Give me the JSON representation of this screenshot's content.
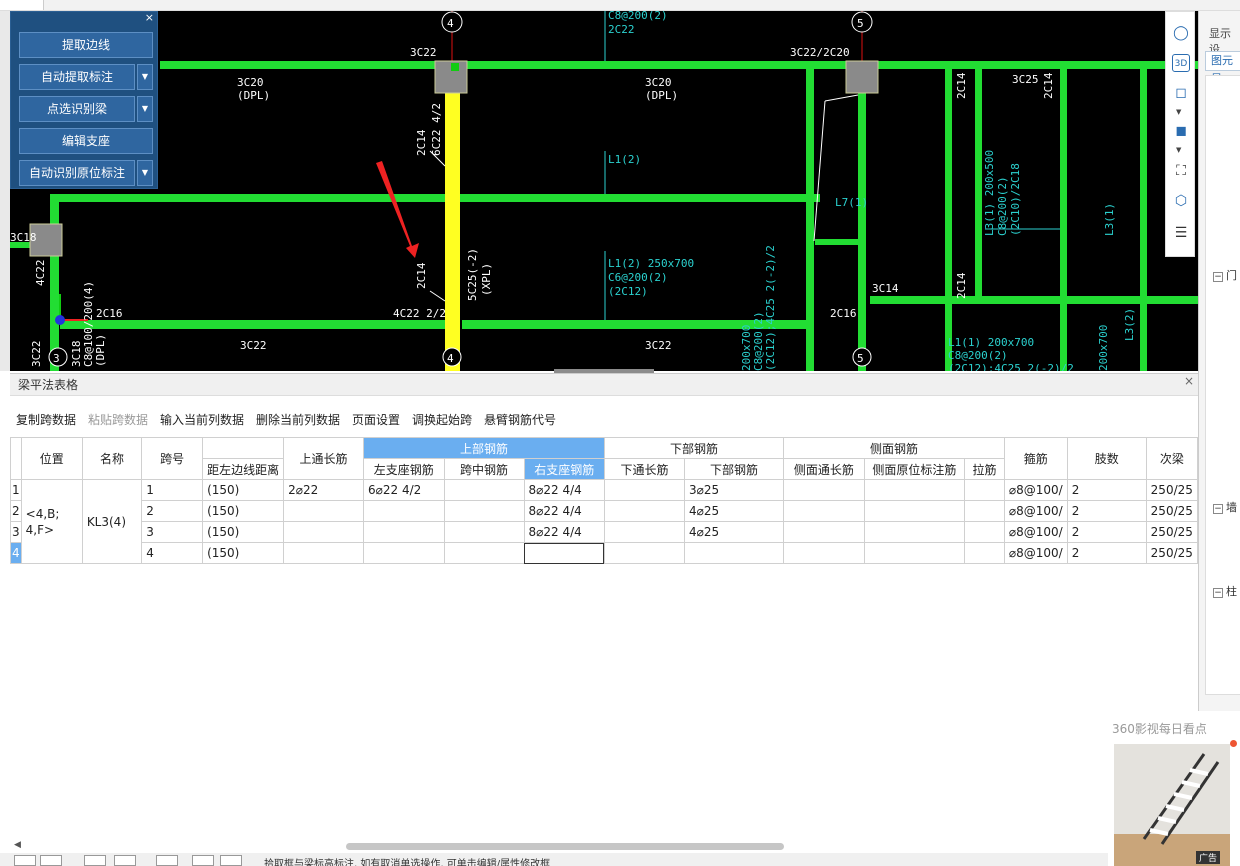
{
  "toolpanel": {
    "buttons": [
      "提取边线",
      "自动提取标注",
      "点选识别梁",
      "编辑支座",
      "自动识别原位标注"
    ],
    "close": "×"
  },
  "canvas": {
    "axis_labels": {
      "top_4": "4",
      "top_5": "5",
      "bottom_3": "3",
      "bottom_4": "4",
      "bottom_5": "5"
    },
    "texts": [
      "3C22",
      "3C22/2C20",
      "3C20",
      "(DPL)",
      "3C20",
      "(DPL)",
      "2C14",
      "6C22 4/2",
      "C8@200(2)",
      "2C22",
      "L1(2)",
      "2C14",
      "3C25",
      "2C14",
      "L7(1)",
      "L3(1) 200x500",
      "C8@200(2)",
      "(2C10)/2C18",
      "L3(1)",
      "2C14",
      "5C25(-2)",
      "(XPL)",
      "L1(2) 250x700",
      "C6@200(2)",
      "(2C12)",
      "3C18",
      "4C22",
      "2C16",
      "4C22 2/2",
      "2C16",
      "3C14",
      "2C14",
      "3C22",
      "3C22",
      "3C22",
      "3C18",
      "C8@100/200(4)",
      "(DPL)",
      "L1(1) 200x700",
      "C8@200(2)",
      "(2C12);4C25 2(-2)/2",
      "200x700",
      "C8@200(2)",
      "(2C12);4C25 2(-2)/2",
      "200x700",
      "L3(2)"
    ]
  },
  "vtool": {
    "icons": [
      "3d-orbit-icon",
      "3d-view-icon",
      "cube-outline-icon",
      "cube-solid-icon",
      "fit-window-icon",
      "select-box-icon",
      "layer-settings-icon"
    ],
    "label_3d": "3D"
  },
  "rightpanel": {
    "title": "显示设",
    "tab": "图元显",
    "sections": [
      "门",
      "墙",
      "柱"
    ],
    "collapse": "−"
  },
  "bottompanel": {
    "title": "梁平法表格",
    "close": "×",
    "toolbar": [
      "复制跨数据",
      "粘贴跨数据",
      "输入当前列数据",
      "删除当前列数据",
      "页面设置",
      "调换起始跨",
      "悬臂钢筋代号"
    ],
    "columns": {
      "position": "位置",
      "name": "名称",
      "span": "跨号",
      "left_dist": "距左边线距离",
      "top_through": "上通长筋",
      "top_group": "上部钢筋",
      "left_support": "左支座钢筋",
      "mid_span": "跨中钢筋",
      "right_support": "右支座钢筋",
      "bottom_group": "下部钢筋",
      "bottom_through": "下通长筋",
      "bottom_bar": "下部钢筋",
      "side_group": "侧面钢筋",
      "side_through": "侧面通长筋",
      "side_in_situ": "侧面原位标注筋",
      "tie": "拉筋",
      "stirrup": "箍筋",
      "legs": "肢数",
      "secondary": "次梁"
    },
    "position": "<4,B;\n4,F>",
    "name": "KL3(4)",
    "rows": [
      {
        "idx": "1",
        "span": "1",
        "left_dist": "(150)",
        "top_through": "2⌀22",
        "left_support": "6⌀22 4/2",
        "mid_span": "",
        "right_support": "8⌀22 4/4",
        "bottom_through": "",
        "bottom_bar": "3⌀25",
        "side_through": "",
        "side_in_situ": "",
        "tie": "",
        "stirrup": "⌀8@100/",
        "legs": "2",
        "secondary": "250/25"
      },
      {
        "idx": "2",
        "span": "2",
        "left_dist": "(150)",
        "top_through": "",
        "left_support": "",
        "mid_span": "",
        "right_support": "8⌀22 4/4",
        "bottom_through": "",
        "bottom_bar": "4⌀25",
        "side_through": "",
        "side_in_situ": "",
        "tie": "",
        "stirrup": "⌀8@100/",
        "legs": "2",
        "secondary": "250/25"
      },
      {
        "idx": "3",
        "span": "3",
        "left_dist": "(150)",
        "top_through": "",
        "left_support": "",
        "mid_span": "",
        "right_support": "8⌀22 4/4",
        "bottom_through": "",
        "bottom_bar": "4⌀25",
        "side_through": "",
        "side_in_situ": "",
        "tie": "",
        "stirrup": "⌀8@100/",
        "legs": "2",
        "secondary": "250/25"
      },
      {
        "idx": "4",
        "span": "4",
        "left_dist": "(150)",
        "top_through": "",
        "left_support": "",
        "mid_span": "",
        "right_support": "",
        "bottom_through": "",
        "bottom_bar": "",
        "side_through": "",
        "side_in_situ": "",
        "tie": "",
        "stirrup": "⌀8@100/",
        "legs": "2",
        "secondary": "250/25"
      }
    ]
  },
  "statusbar": {
    "text": "拾取框与梁标高标注, 如有取消单选操作, 可单击编辑/属性修改框"
  },
  "ad": {
    "title": "360影视每日看点",
    "label": "广告"
  },
  "colors": {
    "beam": "#22dd33",
    "selected_beam": "#ffff22",
    "canvas_bg": "#000000",
    "header_highlight": "#6aaef0",
    "panel_bg": "#1f5080"
  }
}
